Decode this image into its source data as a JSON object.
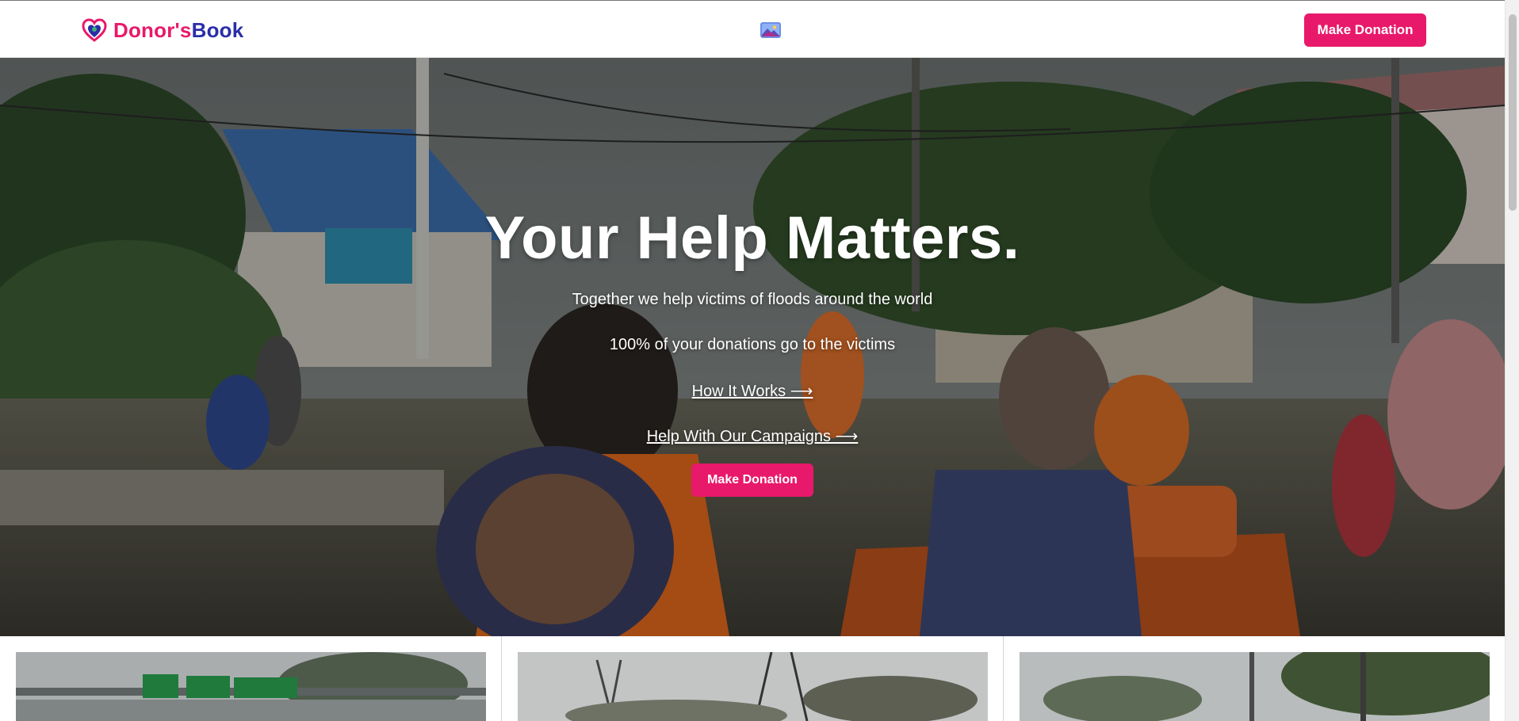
{
  "header": {
    "brand_part1": "Donor's",
    "brand_part2": "Book",
    "logo_icon": "heart-logo-icon",
    "center_icon": "image-icon",
    "donate_label": "Make Donation"
  },
  "hero": {
    "title": "Your Help Matters.",
    "subtitle1": "Together we help victims of floods around the world",
    "subtitle2": "100% of your donations go to the victims",
    "link1": "How It Works ⟶",
    "link2": "Help With Our Campaigns ⟶",
    "donate_label": "Make Donation",
    "photo": "flood-rescue-photo"
  },
  "campaigns": [
    {
      "image": "flooded-highway-photo"
    },
    {
      "image": "flooded-powerlines-photo"
    },
    {
      "image": "flooded-street-photo"
    }
  ],
  "colors": {
    "accent": "#e8196a",
    "brand_blue": "#2b2ea8"
  }
}
